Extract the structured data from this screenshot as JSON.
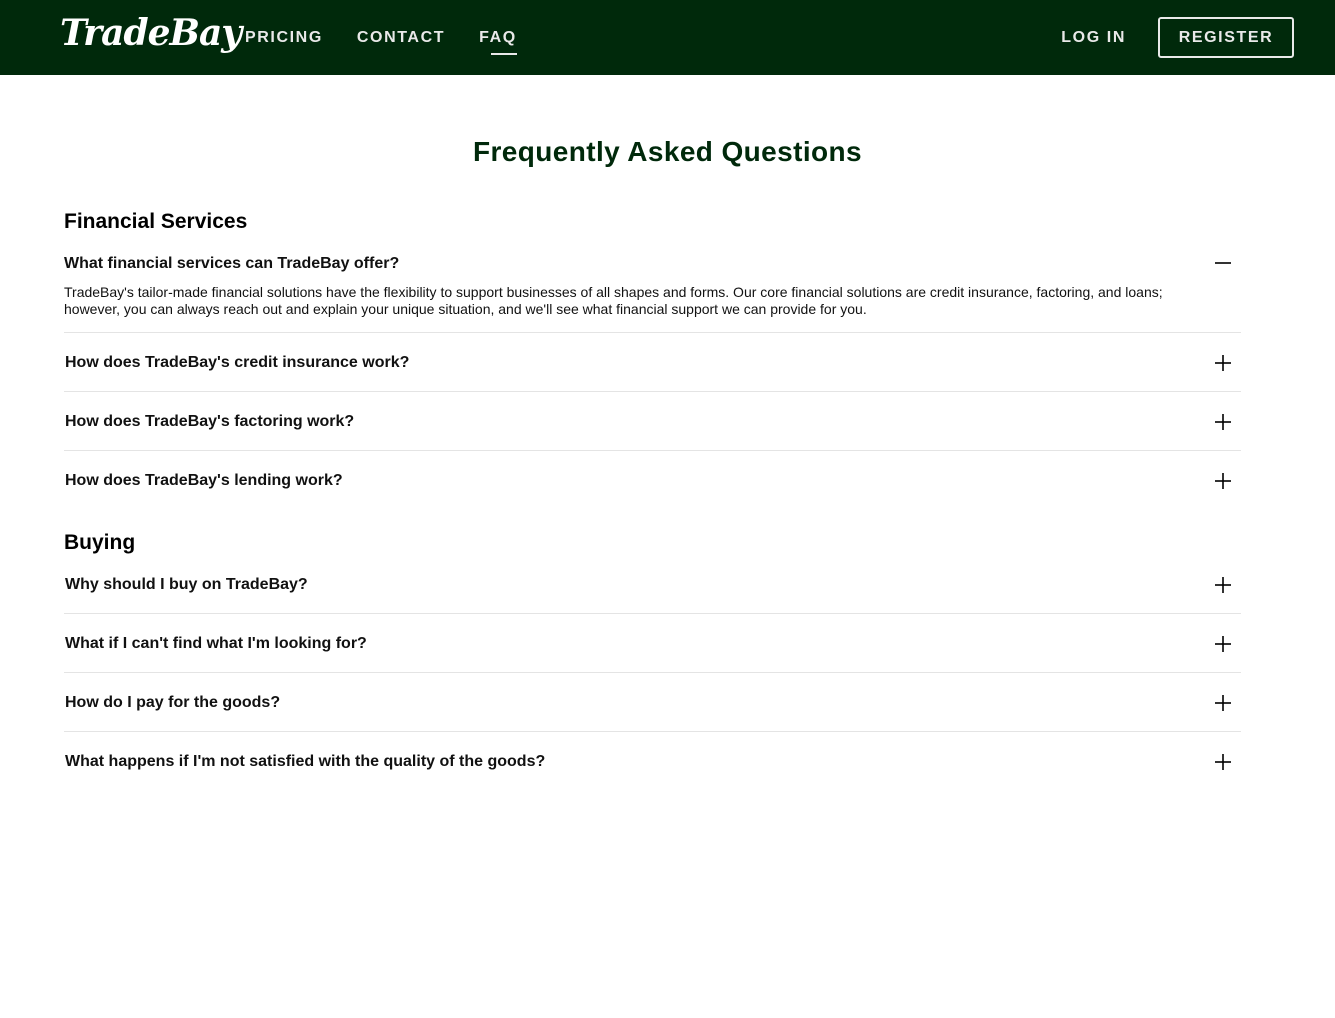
{
  "header": {
    "logo": "TradeBay",
    "nav": [
      {
        "label": "PRICING"
      },
      {
        "label": "CONTACT"
      },
      {
        "label": "FAQ",
        "active": true
      }
    ],
    "login_label": "LOG IN",
    "register_label": "REGISTER"
  },
  "main": {
    "title": "Frequently Asked Questions",
    "sections": [
      {
        "title": "Financial Services",
        "items": [
          {
            "question": "What financial services can TradeBay offer?",
            "answer": "TradeBay's tailor-made financial solutions have the flexibility to support businesses of all shapes and forms. Our core financial solutions are credit insurance, factoring, and loans; however, you can always reach out and explain your unique situation, and we'll see what financial support we can provide for you.",
            "expanded": true
          },
          {
            "question": "How does TradeBay's credit insurance work?",
            "expanded": false
          },
          {
            "question": "How does TradeBay's factoring work?",
            "expanded": false
          },
          {
            "question": "How does TradeBay's lending work?",
            "expanded": false
          }
        ]
      },
      {
        "title": "Buying",
        "items": [
          {
            "question": "Why should I buy on TradeBay?",
            "expanded": false
          },
          {
            "question": "What if I can't find what I'm looking for?",
            "expanded": false
          },
          {
            "question": "How do I pay for the goods?",
            "expanded": false
          },
          {
            "question": "What happens if I'm not satisfied with the quality of the goods?",
            "expanded": false
          }
        ]
      }
    ]
  },
  "colors": {
    "header_bg": "#00290b",
    "title_color": "#00290b",
    "nav_text": "#e9e9e9",
    "divider": "#e4e4e4"
  },
  "icons": {
    "expanded": "minus-icon",
    "collapsed": "plus-icon"
  }
}
